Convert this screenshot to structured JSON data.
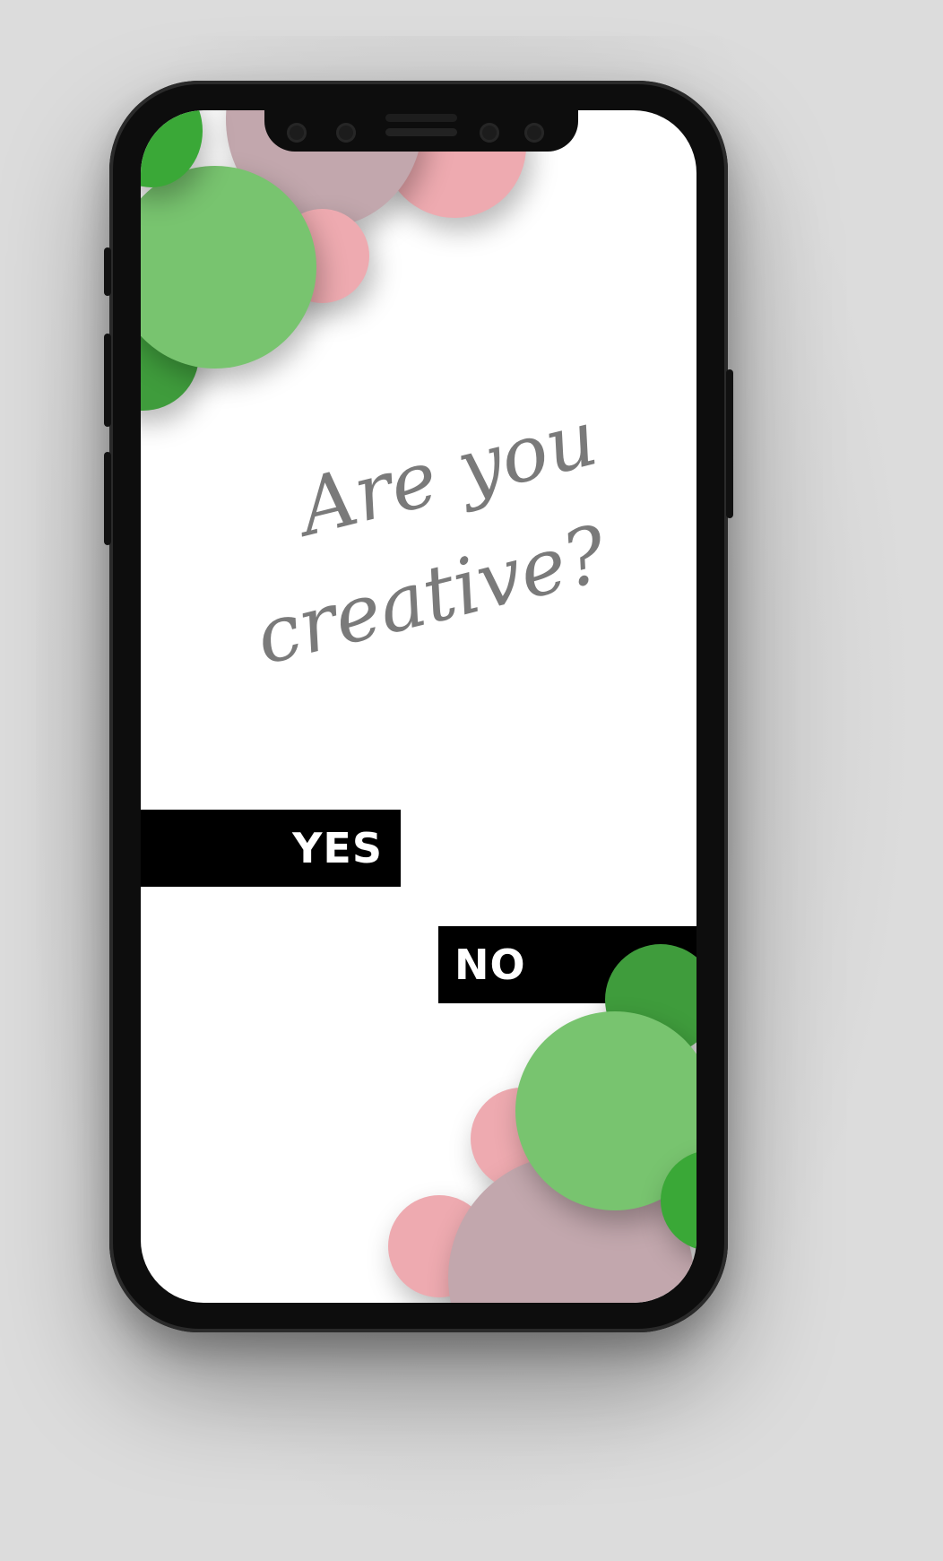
{
  "screen": {
    "headline_line1": "Are you",
    "headline_line2": "creative?"
  },
  "choices": {
    "yes_label": "YES",
    "no_label": "NO"
  },
  "colors": {
    "green_light": "#78c46f",
    "green_mid": "#3f9c3c",
    "green_bright": "#3aa837",
    "pink": "#eeaab0",
    "mauve": "#c2a7ad",
    "text_script": "#7a7a7a",
    "button_bg": "#000000",
    "button_text": "#ffffff"
  }
}
